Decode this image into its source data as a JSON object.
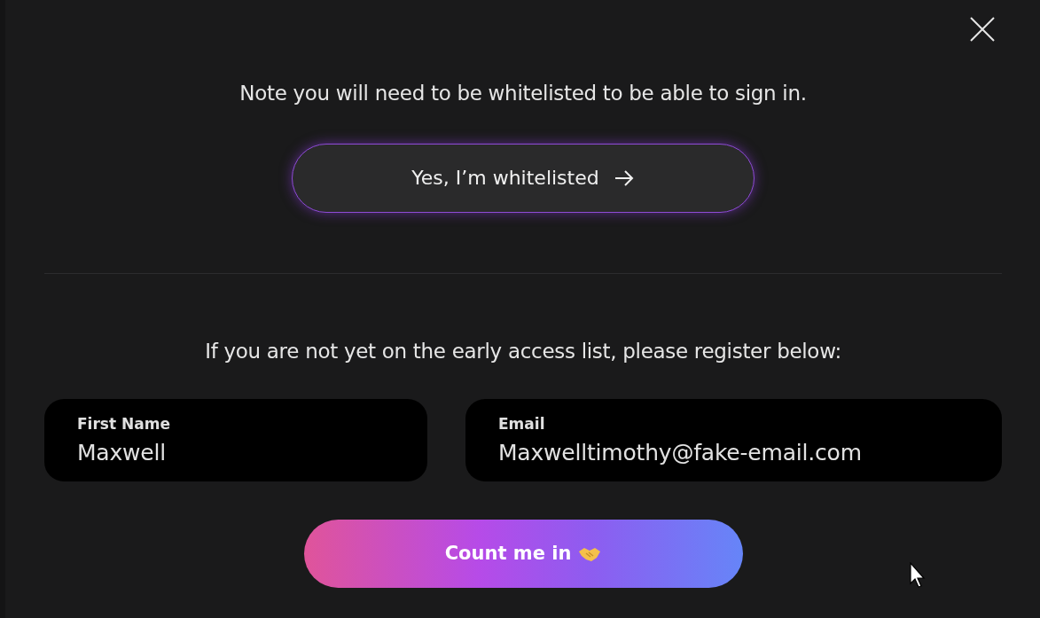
{
  "note": "Note you will need to be whitelisted to be able to sign in.",
  "whitelist_button": {
    "label": "Yes, I’m whitelisted"
  },
  "register_prompt": "If you are not yet on the early access list, please register below:",
  "fields": [
    {
      "label": "First Name",
      "value": "Maxwell"
    },
    {
      "label": "Email",
      "value": "Maxwelltimothy@fake-email.com"
    }
  ],
  "submit_button": {
    "label": "Count me in"
  }
}
